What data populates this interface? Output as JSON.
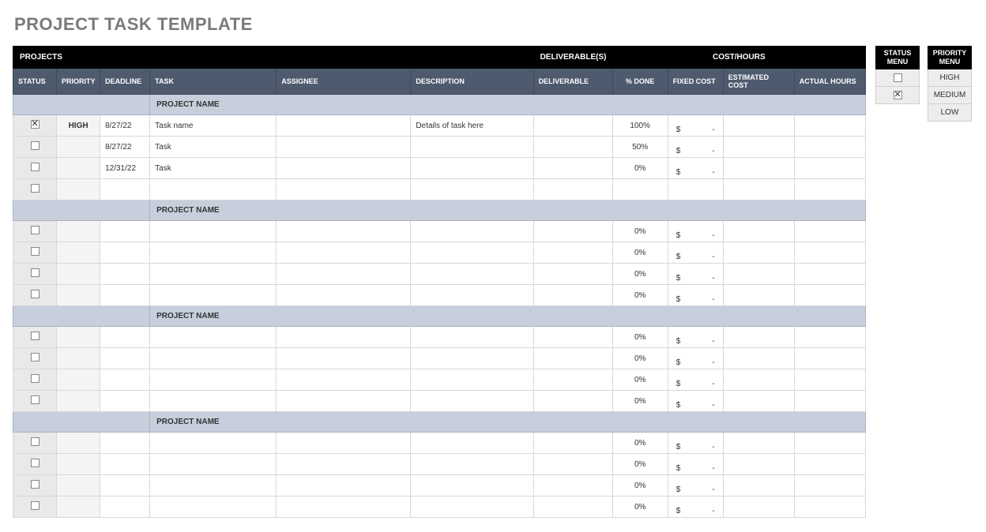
{
  "title": "PROJECT TASK TEMPLATE",
  "superHeaders": {
    "projects": "PROJECTS",
    "deliverables": "DELIVERABLE(S)",
    "costHours": "COST/HOURS"
  },
  "columns": {
    "status": "STATUS",
    "priority": "PRIORITY",
    "deadline": "DEADLINE",
    "task": "TASK",
    "assignee": "ASSIGNEE",
    "description": "DESCRIPTION",
    "deliverable": "DELIVERABLE",
    "pctDone": "% DONE",
    "fixedCost": "FIXED COST",
    "estimatedCost": "ESTIMATED COST",
    "actualHours": "ACTUAL HOURS"
  },
  "currency": "$",
  "empty": "-",
  "projects": [
    {
      "name": "PROJECT NAME",
      "rows": [
        {
          "checked": true,
          "priority": "HIGH",
          "deadline": "8/27/22",
          "task": "Task name",
          "assignee": "",
          "description": "Details of task here",
          "deliverable": "",
          "pctDone": "100%",
          "hasCost": true
        },
        {
          "checked": false,
          "priority": "",
          "deadline": "8/27/22",
          "task": "Task",
          "assignee": "",
          "description": "",
          "deliverable": "",
          "pctDone": "50%",
          "hasCost": true
        },
        {
          "checked": false,
          "priority": "",
          "deadline": "12/31/22",
          "task": "Task",
          "assignee": "",
          "description": "",
          "deliverable": "",
          "pctDone": "0%",
          "hasCost": true
        },
        {
          "checked": false,
          "priority": "",
          "deadline": "",
          "task": "",
          "assignee": "",
          "description": "",
          "deliverable": "",
          "pctDone": "",
          "hasCost": false
        }
      ]
    },
    {
      "name": "PROJECT NAME",
      "rows": [
        {
          "checked": false,
          "priority": "",
          "deadline": "",
          "task": "",
          "assignee": "",
          "description": "",
          "deliverable": "",
          "pctDone": "0%",
          "hasCost": true
        },
        {
          "checked": false,
          "priority": "",
          "deadline": "",
          "task": "",
          "assignee": "",
          "description": "",
          "deliverable": "",
          "pctDone": "0%",
          "hasCost": true
        },
        {
          "checked": false,
          "priority": "",
          "deadline": "",
          "task": "",
          "assignee": "",
          "description": "",
          "deliverable": "",
          "pctDone": "0%",
          "hasCost": true
        },
        {
          "checked": false,
          "priority": "",
          "deadline": "",
          "task": "",
          "assignee": "",
          "description": "",
          "deliverable": "",
          "pctDone": "0%",
          "hasCost": true
        }
      ]
    },
    {
      "name": "PROJECT NAME",
      "rows": [
        {
          "checked": false,
          "priority": "",
          "deadline": "",
          "task": "",
          "assignee": "",
          "description": "",
          "deliverable": "",
          "pctDone": "0%",
          "hasCost": true
        },
        {
          "checked": false,
          "priority": "",
          "deadline": "",
          "task": "",
          "assignee": "",
          "description": "",
          "deliverable": "",
          "pctDone": "0%",
          "hasCost": true
        },
        {
          "checked": false,
          "priority": "",
          "deadline": "",
          "task": "",
          "assignee": "",
          "description": "",
          "deliverable": "",
          "pctDone": "0%",
          "hasCost": true
        },
        {
          "checked": false,
          "priority": "",
          "deadline": "",
          "task": "",
          "assignee": "",
          "description": "",
          "deliverable": "",
          "pctDone": "0%",
          "hasCost": true
        }
      ]
    },
    {
      "name": "PROJECT NAME",
      "rows": [
        {
          "checked": false,
          "priority": "",
          "deadline": "",
          "task": "",
          "assignee": "",
          "description": "",
          "deliverable": "",
          "pctDone": "0%",
          "hasCost": true
        },
        {
          "checked": false,
          "priority": "",
          "deadline": "",
          "task": "",
          "assignee": "",
          "description": "",
          "deliverable": "",
          "pctDone": "0%",
          "hasCost": true
        },
        {
          "checked": false,
          "priority": "",
          "deadline": "",
          "task": "",
          "assignee": "",
          "description": "",
          "deliverable": "",
          "pctDone": "0%",
          "hasCost": true
        },
        {
          "checked": false,
          "priority": "",
          "deadline": "",
          "task": "",
          "assignee": "",
          "description": "",
          "deliverable": "",
          "pctDone": "0%",
          "hasCost": true
        }
      ]
    }
  ],
  "statusMenu": {
    "title": "STATUS MENU",
    "items": [
      {
        "checked": false
      },
      {
        "checked": true
      }
    ]
  },
  "priorityMenu": {
    "title": "PRIORITY MENU",
    "items": [
      "HIGH",
      "MEDIUM",
      "LOW"
    ]
  }
}
